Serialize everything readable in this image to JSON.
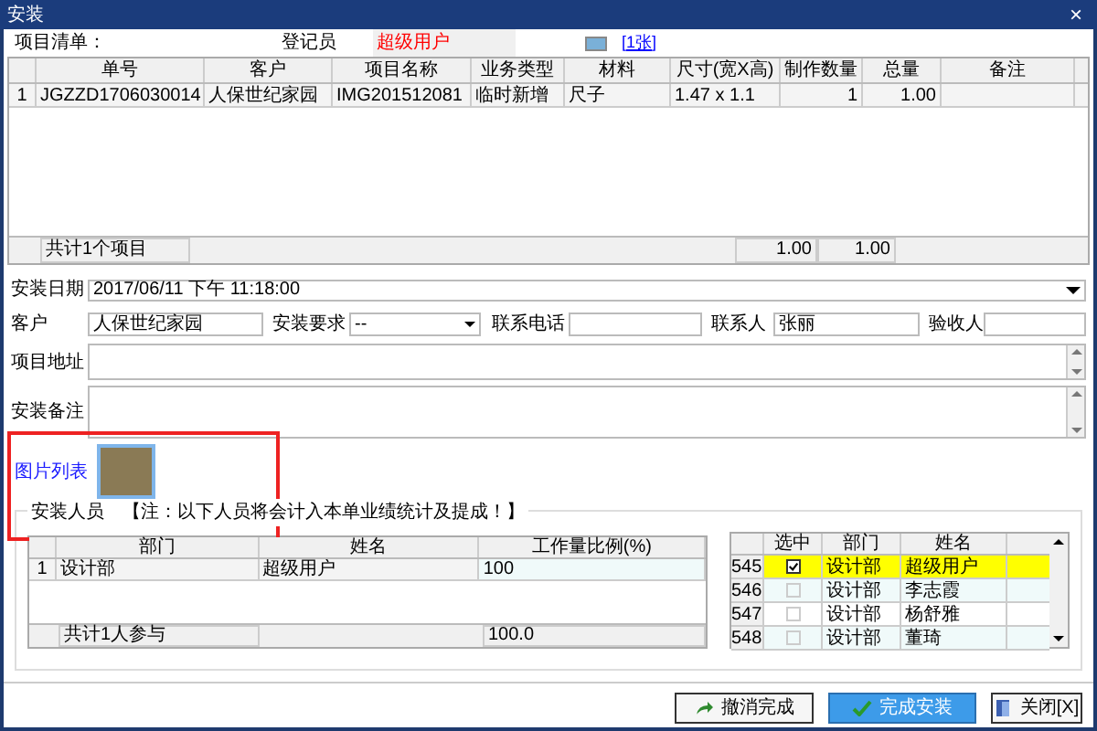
{
  "window": {
    "title": "安装",
    "close": "×"
  },
  "header": {
    "list_label": "项目清单：",
    "registrar_label": "登记员",
    "registrar_value": "超级用户",
    "image_link": "[1张]"
  },
  "items_table": {
    "columns": [
      "单号",
      "客户",
      "项目名称",
      "业务类型",
      "材料",
      "尺寸(宽X高)",
      "制作数量",
      "总量",
      "备注"
    ],
    "rows": [
      {
        "index": "1",
        "cells": [
          "JGZZD1706030014",
          "人保世纪家园",
          "IMG201512081",
          "临时新增",
          "尺子",
          "1.47 x 1.1",
          "1",
          "1.00",
          ""
        ]
      }
    ],
    "footer": {
      "summary": "共计1个项目",
      "quantity_total": "1.00",
      "total": "1.00"
    }
  },
  "form": {
    "date_label": "安装日期",
    "date_value": "2017/06/11 下午 11:18:00",
    "customer_label": "客户",
    "customer_value": "人保世纪家园",
    "requirement_label": "安装要求",
    "requirement_value": "--",
    "phone_label": "联系电话",
    "contact_label": "联系人",
    "contact_value": "张丽",
    "inspector_label": "验收人",
    "address_label": "项目地址",
    "notes_label": "安装备注",
    "images_label": "图片列表"
  },
  "staff": {
    "title": "安装人员",
    "note": "【注：以下人员将会计入本单业绩统计及提成！】",
    "columns": [
      "部门",
      "姓名",
      "工作量比例(%)"
    ],
    "rows": [
      {
        "index": "1",
        "department": "设计部",
        "name": "超级用户",
        "ratio": "100"
      }
    ],
    "footer": {
      "summary": "共计1人参与",
      "ratio_total": "100.0"
    }
  },
  "picker": {
    "columns": [
      "选中",
      "部门",
      "姓名"
    ],
    "rows": [
      {
        "index": "545",
        "checked": true,
        "selected": true,
        "department": "设计部",
        "name": "超级用户"
      },
      {
        "index": "546",
        "checked": false,
        "selected": false,
        "department": "设计部",
        "name": "李志霞"
      },
      {
        "index": "547",
        "checked": false,
        "selected": false,
        "department": "设计部",
        "name": "杨舒雅"
      },
      {
        "index": "548",
        "checked": false,
        "selected": false,
        "department": "设计部",
        "name": "董琦"
      }
    ]
  },
  "buttons": [
    {
      "kind": "undo",
      "label": "撤消完成",
      "primary": false
    },
    {
      "kind": "confirm",
      "label": "完成安装",
      "primary": true
    },
    {
      "kind": "close",
      "label": "关闭[X]",
      "primary": false
    }
  ]
}
